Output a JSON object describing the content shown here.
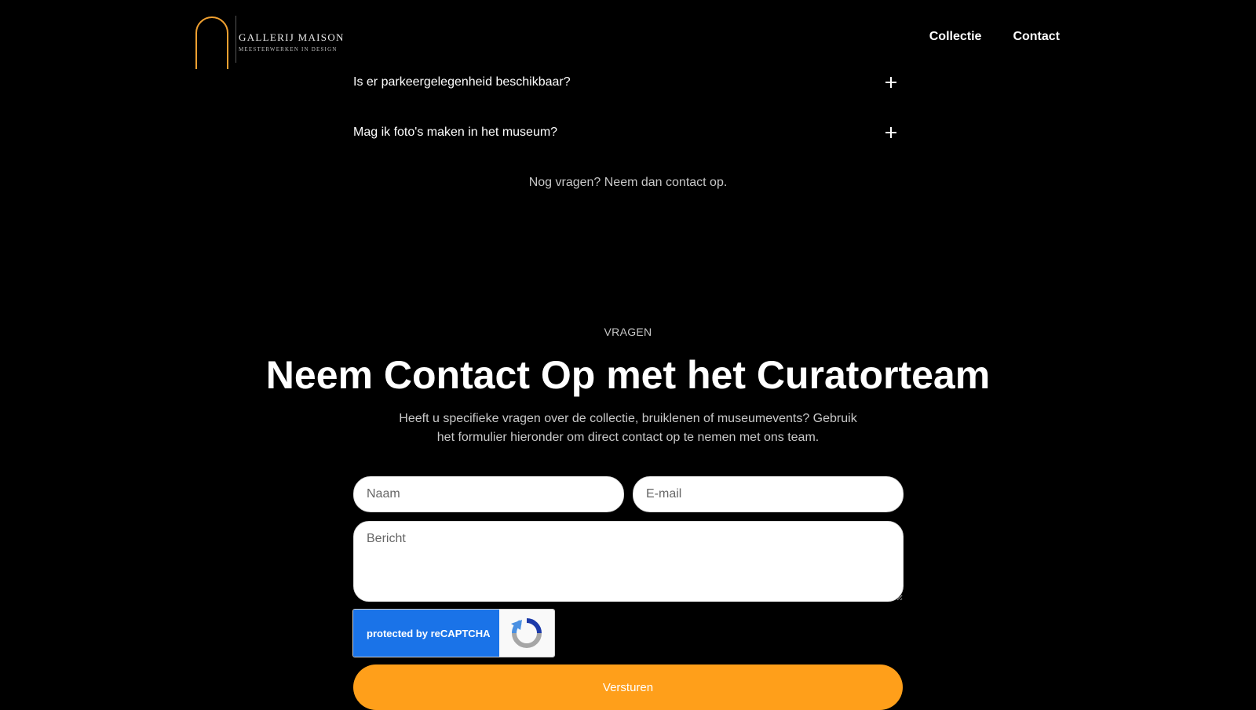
{
  "header": {
    "logo": {
      "title": "GALLERIJ MAISON",
      "subtitle": "MEESTERWERKEN IN DESIGN"
    },
    "nav": [
      {
        "label": "Collectie"
      },
      {
        "label": "Contact"
      }
    ]
  },
  "faq": {
    "items": [
      {
        "question": "Is er parkeergelegenheid beschikbaar?",
        "icon": "plus-icon"
      },
      {
        "question": "Mag ik foto's maken in het museum?",
        "icon": "plus-icon"
      }
    ],
    "more": "Nog vragen? Neem dan contact op."
  },
  "contact": {
    "eyebrow": "VRAGEN",
    "heading": "Neem Contact Op met het Curatorteam",
    "intro": "Heeft u specifieke vragen over de collectie, bruiklenen of museumevents? Gebruik het formulier hieronder om direct contact op te nemen met ons team.",
    "form": {
      "name": {
        "placeholder": "Naam",
        "value": ""
      },
      "email": {
        "placeholder": "E-mail",
        "value": ""
      },
      "message": {
        "placeholder": "Bericht",
        "value": ""
      },
      "recaptcha_label": "protected by reCAPTCHA",
      "submit_label": "Versturen"
    }
  },
  "colors": {
    "background": "#000000",
    "accent": "#ff9f1a",
    "recaptcha_blue": "#1a73e8"
  }
}
